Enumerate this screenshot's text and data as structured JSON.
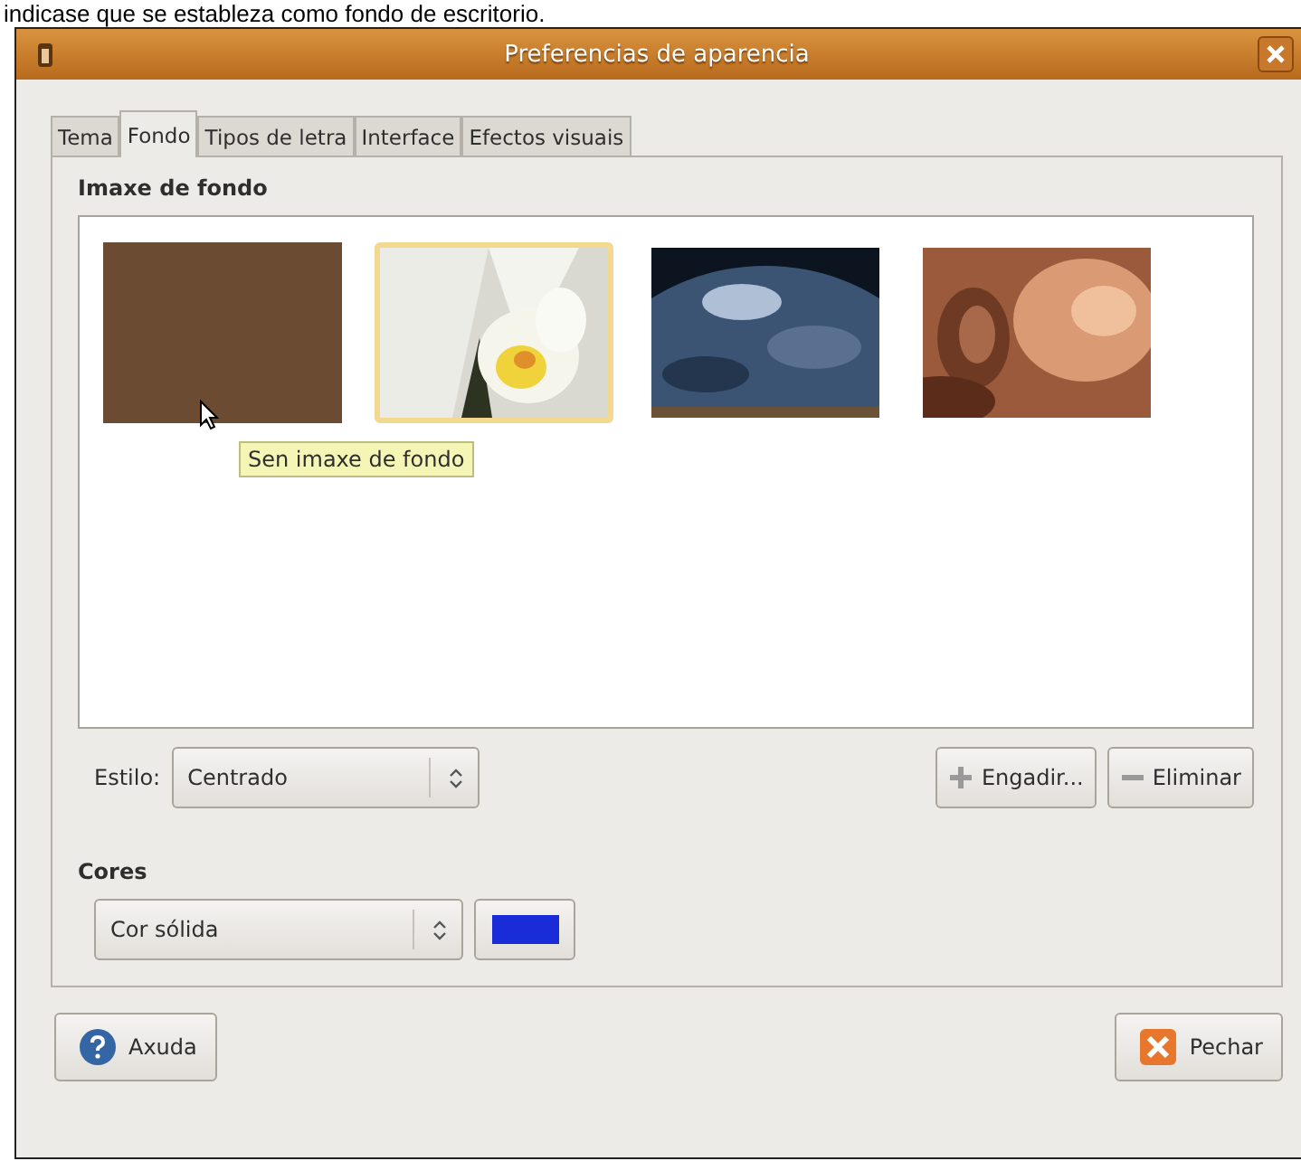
{
  "caption": "indicase que se estableza como fondo de escritorio.",
  "window": {
    "title": "Preferencias de aparencia"
  },
  "tabs": [
    {
      "label": "Tema",
      "selected": false
    },
    {
      "label": "Fondo",
      "selected": true
    },
    {
      "label": "Tipos de letra",
      "selected": false
    },
    {
      "label": "Interface",
      "selected": false
    },
    {
      "label": "Efectos visuais",
      "selected": false
    }
  ],
  "background": {
    "heading": "Imaxe de fondo",
    "wallpapers": [
      {
        "kind": "color",
        "color": "#6b4c32",
        "selected": false
      },
      {
        "kind": "picture",
        "selected": true
      },
      {
        "kind": "picture",
        "selected": false
      },
      {
        "kind": "picture",
        "selected": false
      }
    ],
    "tooltip": "Sen imaxe de fondo",
    "style_label": "Estilo:",
    "style_value": "Centrado",
    "add_button": "Engadir...",
    "remove_button": "Eliminar"
  },
  "colors": {
    "heading": "Cores",
    "mode": "Cor sólida",
    "color": "#1a2bd8"
  },
  "help_button": "Axuda",
  "close_button": "Pechar"
}
